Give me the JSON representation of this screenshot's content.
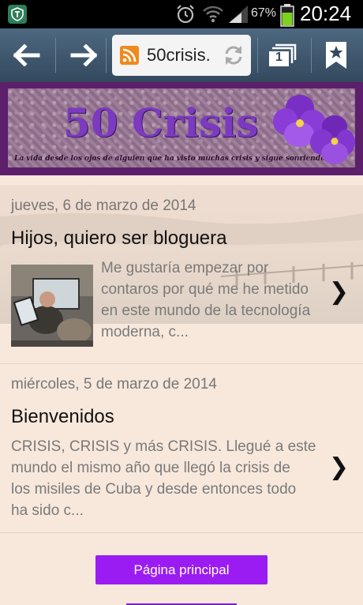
{
  "status_bar": {
    "battery_percent": "67%",
    "time": "20:24",
    "icons": [
      "app-shield-icon",
      "alarm-icon",
      "wifi-icon",
      "signal-icon",
      "battery-icon"
    ]
  },
  "browser": {
    "url": "50crisis.",
    "tab_count": "1",
    "icons": [
      "back-arrow-icon",
      "forward-arrow-icon",
      "rss-icon",
      "reload-icon",
      "tabs-icon",
      "bookmark-icon"
    ]
  },
  "blog": {
    "title": "50 Crisis",
    "tagline": "La vida desde los ojos de alguien que ha visto muchas crisis y sigue sonriendo."
  },
  "posts": [
    {
      "date": "jueves, 6 de marzo de 2014",
      "title": "Hijos, quiero ser bloguera",
      "excerpt_lines": [
        "Me gustaría empezar por",
        "contaros por qué me he metido",
        "en este mundo de la tecnología",
        "moderna, c..."
      ]
    },
    {
      "date": "miércoles, 5 de marzo de 2014",
      "title": "Bienvenidos",
      "excerpt_lines": [
        "CRISIS, CRISIS y más CRISIS. Llegué a este",
        "mundo el mismo año que llegó la crisis de",
        "los misiles de Cuba y desde entonces todo",
        "ha sido c..."
      ]
    }
  ],
  "footer": {
    "home_button": "Página principal"
  },
  "colors": {
    "accent_purple": "#9b1cf2",
    "header_purple": "#5c1f6b",
    "page_background": "#f8e8dc"
  }
}
